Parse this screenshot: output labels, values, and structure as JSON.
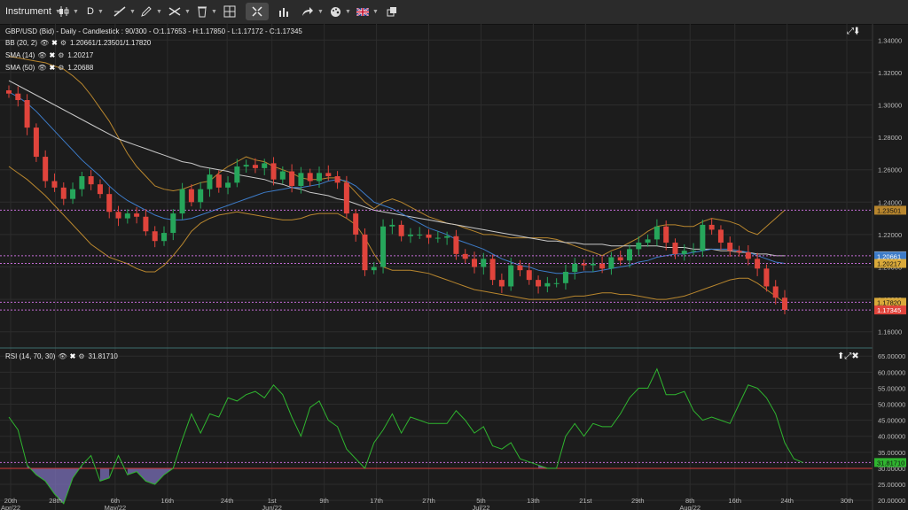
{
  "toolbar": {
    "instrument_label": "Instrument",
    "timeframe_label": "D"
  },
  "header": {
    "info": "GBP/USD (Bid) - Daily - Candlestick : 90/300 - O:1.17653 - H:1.17850 - L:1.17172 - C:1.17345"
  },
  "legends": {
    "bb_name": "BB (20, 2)",
    "bb_value": "1.20661/1.23501/1.17820",
    "sma14_name": "SMA (14)",
    "sma14_value": "1.20217",
    "sma50_name": "SMA (50)",
    "sma50_value": "1.20688",
    "rsi_name": "RSI (14, 70, 30)",
    "rsi_value": "31.81710"
  },
  "colors": {
    "background": "#1c1c1c",
    "bull": "#26a65b",
    "bear": "#e0443c",
    "bb": "#b8862e",
    "sma14": "#3d7cc9",
    "sma50": "#c8c8c8",
    "rsi": "#2fb52f",
    "rsi_fill": "#7a6fb8",
    "grid": "#2c2c2c"
  },
  "chart_data": [
    {
      "type": "candlestick",
      "title": "GBP/USD (Bid) - Daily - Candlestick",
      "ylim": [
        1.15,
        1.35
      ],
      "y_ticks": [
        "1.34000",
        "1.32000",
        "1.30000",
        "1.28000",
        "1.26000",
        "1.24000",
        "1.22000",
        "1.20000",
        "1.18000",
        "1.16000"
      ],
      "x_ticks": [
        "20th",
        "28th",
        "6th",
        "16th",
        "24th",
        "1st",
        "9th",
        "17th",
        "27th",
        "5th",
        "13th",
        "21st",
        "29th",
        "8th",
        "16th",
        "24th",
        "30th"
      ],
      "x_tick_subs": [
        "Apr/22",
        "",
        "May/22",
        "",
        "",
        "Jun/22",
        "",
        "",
        "",
        "Jul/22",
        "",
        "",
        "",
        "Aug/22",
        "",
        "",
        ""
      ],
      "price_labels": [
        {
          "text": "1.23501",
          "color": "#b8862e"
        },
        {
          "text": "1.20688",
          "color": "#c8c8c8"
        },
        {
          "text": "1.20661",
          "color": "#3d7cc9"
        },
        {
          "text": "1.20217",
          "color": "#d9a93a"
        },
        {
          "text": "1.17820",
          "color": "#d9a93a"
        },
        {
          "text": "1.17345",
          "color": "#e0443c"
        }
      ],
      "closes": [
        1.307,
        1.303,
        1.286,
        1.268,
        1.253,
        1.249,
        1.242,
        1.248,
        1.256,
        1.251,
        1.245,
        1.234,
        1.23,
        1.233,
        1.231,
        1.222,
        1.216,
        1.221,
        1.233,
        1.248,
        1.24,
        1.248,
        1.257,
        1.249,
        1.252,
        1.262,
        1.263,
        1.261,
        1.264,
        1.254,
        1.259,
        1.25,
        1.258,
        1.253,
        1.258,
        1.256,
        1.252,
        1.233,
        1.22,
        1.198,
        1.2,
        1.225,
        1.226,
        1.219,
        1.22,
        1.22,
        1.218,
        1.218,
        1.219,
        1.208,
        1.205,
        1.2,
        1.205,
        1.192,
        1.188,
        1.201,
        1.198,
        1.192,
        1.188,
        1.19,
        1.19,
        1.197,
        1.202,
        1.201,
        1.202,
        1.199,
        1.206,
        1.204,
        1.211,
        1.215,
        1.217,
        1.225,
        1.215,
        1.208,
        1.21,
        1.21,
        1.226,
        1.223,
        1.215,
        1.21,
        1.209,
        1.205,
        1.199,
        1.188,
        1.181,
        1.1735
      ],
      "bb_upper": [
        1.33,
        1.329,
        1.328,
        1.327,
        1.326,
        1.324,
        1.322,
        1.318,
        1.313,
        1.306,
        1.298,
        1.29,
        1.28,
        1.27,
        1.262,
        1.256,
        1.25,
        1.248,
        1.247,
        1.248,
        1.25,
        1.252,
        1.253,
        1.258,
        1.262,
        1.265,
        1.268,
        1.266,
        1.265,
        1.262,
        1.26,
        1.258,
        1.255,
        1.254,
        1.254,
        1.255,
        1.255,
        1.252,
        1.246,
        1.24,
        1.236,
        1.24,
        1.242,
        1.24,
        1.237,
        1.234,
        1.231,
        1.229,
        1.227,
        1.226,
        1.224,
        1.222,
        1.22,
        1.22,
        1.219,
        1.218,
        1.218,
        1.218,
        1.218,
        1.218,
        1.217,
        1.215,
        1.213,
        1.211,
        1.209,
        1.207,
        1.21,
        1.212,
        1.215,
        1.218,
        1.222,
        1.225,
        1.226,
        1.226,
        1.225,
        1.225,
        1.228,
        1.23,
        1.229,
        1.228,
        1.226,
        1.222,
        1.22,
        1.225,
        1.23,
        1.235
      ],
      "bb_lower": [
        1.262,
        1.258,
        1.254,
        1.249,
        1.244,
        1.238,
        1.232,
        1.226,
        1.22,
        1.214,
        1.21,
        1.206,
        1.204,
        1.202,
        1.199,
        1.197,
        1.197,
        1.201,
        1.207,
        1.214,
        1.222,
        1.227,
        1.23,
        1.232,
        1.233,
        1.234,
        1.233,
        1.232,
        1.231,
        1.23,
        1.229,
        1.229,
        1.23,
        1.232,
        1.233,
        1.233,
        1.233,
        1.23,
        1.226,
        1.218,
        1.208,
        1.2,
        1.198,
        1.198,
        1.198,
        1.197,
        1.196,
        1.194,
        1.192,
        1.19,
        1.188,
        1.186,
        1.185,
        1.184,
        1.183,
        1.182,
        1.181,
        1.18,
        1.18,
        1.18,
        1.18,
        1.181,
        1.182,
        1.182,
        1.183,
        1.184,
        1.184,
        1.183,
        1.183,
        1.182,
        1.181,
        1.18,
        1.18,
        1.181,
        1.182,
        1.184,
        1.186,
        1.188,
        1.19,
        1.192,
        1.193,
        1.193,
        1.19,
        1.186,
        1.182,
        1.178
      ],
      "sma14": [
        1.308,
        1.305,
        1.301,
        1.296,
        1.29,
        1.284,
        1.278,
        1.272,
        1.266,
        1.261,
        1.256,
        1.25,
        1.245,
        1.241,
        1.238,
        1.235,
        1.232,
        1.23,
        1.229,
        1.229,
        1.23,
        1.232,
        1.234,
        1.236,
        1.238,
        1.24,
        1.242,
        1.244,
        1.246,
        1.247,
        1.248,
        1.249,
        1.249,
        1.25,
        1.251,
        1.253,
        1.254,
        1.253,
        1.25,
        1.245,
        1.24,
        1.238,
        1.236,
        1.233,
        1.23,
        1.227,
        1.224,
        1.222,
        1.22,
        1.217,
        1.215,
        1.213,
        1.211,
        1.208,
        1.205,
        1.203,
        1.201,
        1.2,
        1.198,
        1.197,
        1.196,
        1.196,
        1.196,
        1.197,
        1.197,
        1.198,
        1.199,
        1.2,
        1.201,
        1.203,
        1.204,
        1.206,
        1.207,
        1.208,
        1.208,
        1.209,
        1.21,
        1.211,
        1.211,
        1.211,
        1.21,
        1.209,
        1.207,
        1.205,
        1.203,
        1.2022
      ],
      "sma50": [
        1.315,
        1.312,
        1.309,
        1.306,
        1.303,
        1.3,
        1.297,
        1.294,
        1.291,
        1.288,
        1.285,
        1.282,
        1.279,
        1.277,
        1.275,
        1.273,
        1.271,
        1.269,
        1.267,
        1.265,
        1.264,
        1.262,
        1.261,
        1.26,
        1.259,
        1.257,
        1.256,
        1.255,
        1.254,
        1.252,
        1.251,
        1.249,
        1.248,
        1.246,
        1.245,
        1.244,
        1.242,
        1.241,
        1.239,
        1.237,
        1.235,
        1.234,
        1.233,
        1.232,
        1.231,
        1.23,
        1.229,
        1.228,
        1.227,
        1.226,
        1.225,
        1.224,
        1.223,
        1.222,
        1.221,
        1.22,
        1.219,
        1.218,
        1.217,
        1.216,
        1.216,
        1.215,
        1.215,
        1.214,
        1.214,
        1.214,
        1.213,
        1.213,
        1.213,
        1.213,
        1.213,
        1.213,
        1.212,
        1.212,
        1.212,
        1.211,
        1.211,
        1.211,
        1.21,
        1.21,
        1.209,
        1.209,
        1.208,
        1.208,
        1.207,
        1.2069
      ],
      "h_lines": [
        1.23501,
        1.20688,
        1.20217,
        1.1782,
        1.17345
      ]
    },
    {
      "type": "line",
      "title": "RSI (14, 70, 30)",
      "ylim": [
        17,
        67
      ],
      "y_ticks": [
        "65.00000",
        "60.00000",
        "55.00000",
        "50.00000",
        "45.00000",
        "40.00000",
        "35.00000",
        "30.00000",
        "25.00000",
        "20.00000"
      ],
      "current_label": "31.81710",
      "overbought": 70,
      "oversold": 30,
      "values": [
        46,
        42,
        31,
        28,
        26,
        22,
        19,
        27,
        31,
        34,
        26,
        27,
        34,
        28,
        29,
        26,
        25,
        28,
        30,
        39,
        47,
        41,
        47,
        46,
        52,
        51,
        53,
        54,
        52,
        56,
        53,
        46,
        40,
        49,
        51,
        45,
        43,
        36,
        33,
        30,
        38,
        42,
        47,
        41,
        46,
        45,
        44,
        44,
        44,
        48,
        45,
        41,
        43,
        37,
        36,
        38,
        33,
        32,
        31,
        30,
        30,
        40,
        44,
        40,
        44,
        43,
        43,
        47,
        52,
        55,
        55,
        61,
        53,
        53,
        54,
        48,
        45,
        46,
        45,
        44,
        50,
        56,
        55,
        52,
        47,
        38,
        33,
        31.8
      ]
    }
  ]
}
